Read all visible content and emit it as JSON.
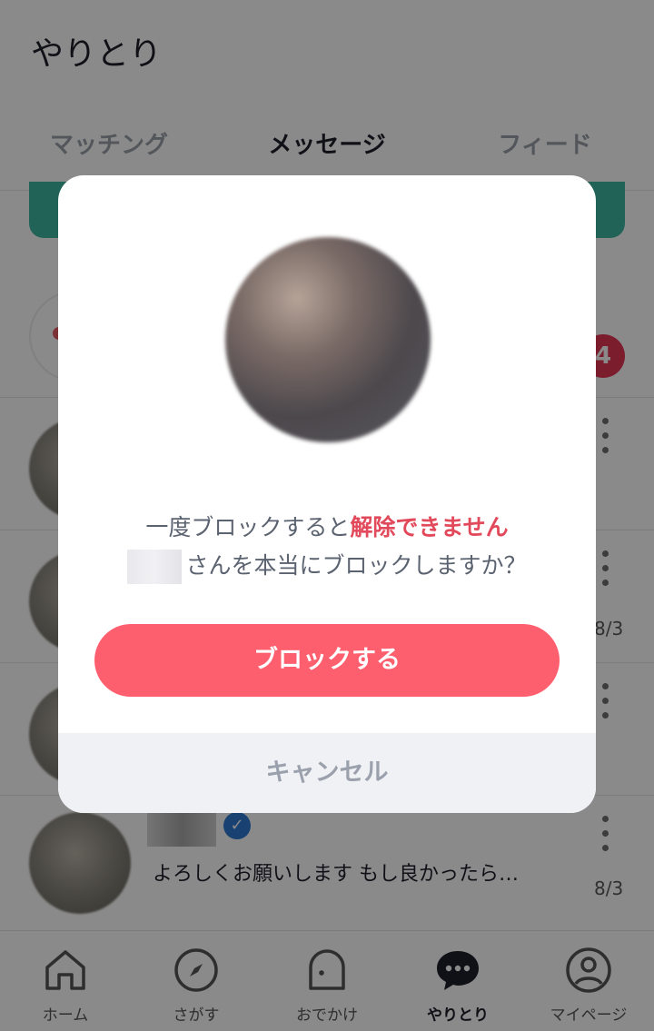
{
  "header": {
    "title": "やりとり"
  },
  "tabs": [
    {
      "label": "マッチング"
    },
    {
      "label": "メッセージ"
    },
    {
      "label": "フィード"
    }
  ],
  "match_row": {
    "badge_count": "4"
  },
  "rows": [
    {
      "date": ""
    },
    {
      "date": "8/3"
    },
    {
      "date": ""
    }
  ],
  "last_row": {
    "preview": "よろしくお願いします もし良かったら…",
    "date": "8/3"
  },
  "bottom_nav": [
    {
      "label": "ホーム",
      "icon": "home-icon"
    },
    {
      "label": "さがす",
      "icon": "compass-icon"
    },
    {
      "label": "おでかけ",
      "icon": "ghost-icon"
    },
    {
      "label": "やりとり",
      "icon": "chat-bubble-icon"
    },
    {
      "label": "マイページ",
      "icon": "user-icon"
    }
  ],
  "dialog": {
    "line1_prefix": "一度ブロックすると",
    "line1_warning": "解除できません",
    "line2_suffix": "さんを本当にブロックしますか？",
    "block_label": "ブロックする",
    "cancel_label": "キャンセル"
  },
  "colors": {
    "accent": "#fe5f6e",
    "warning": "#e24a5c",
    "badge": "#e63756",
    "verified": "#2f78d1",
    "banner": "#3fb7a3"
  }
}
